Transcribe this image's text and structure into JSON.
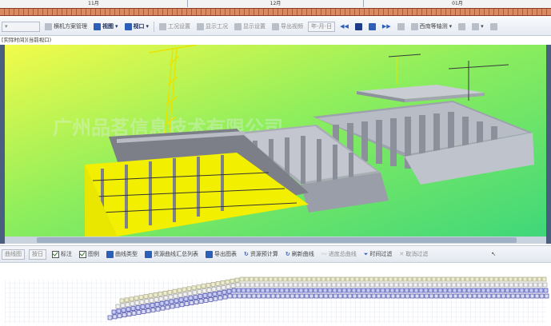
{
  "timeline": {
    "months": [
      "11月",
      "12月",
      "01月"
    ]
  },
  "toolbar": {
    "items": [
      {
        "label": "横机方案管理",
        "icon": "scheme-icon"
      },
      {
        "label": "视图",
        "icon": "view-icon"
      },
      {
        "label": "视口",
        "icon": "viewport-icon"
      },
      {
        "label": "工况设置",
        "icon": "condition-settings-icon"
      },
      {
        "label": "显示工况",
        "icon": "show-condition-icon"
      },
      {
        "label": "显示设置",
        "icon": "display-settings-icon"
      },
      {
        "label": "导出视频",
        "icon": "export-video-icon"
      }
    ],
    "date_format": "年-月-日",
    "view_mode": "西南等轴测"
  },
  "view_label": "[实际时间](当前视口)",
  "viewport": {
    "watermark": "广州品茗信息技术有限公司"
  },
  "bottom_toolbar": {
    "curve_select": "曲线图",
    "unit_select": "按日",
    "mark_label": "标注",
    "legend_label": "图例",
    "items": [
      {
        "label": "曲线类型",
        "icon": "curve-type-icon",
        "dim": false
      },
      {
        "label": "资源曲线汇总列表",
        "icon": "resource-list-icon",
        "dim": false
      },
      {
        "label": "导出图表",
        "icon": "export-chart-icon",
        "dim": false
      },
      {
        "label": "资源预计算",
        "icon": "precompute-icon",
        "dim": false
      },
      {
        "label": "刷新曲线",
        "icon": "refresh-icon",
        "dim": false
      },
      {
        "label": "进度总曲线",
        "icon": "progress-curve-icon",
        "dim": true
      },
      {
        "label": "时间过滤",
        "icon": "time-filter-icon",
        "dim": false
      },
      {
        "label": "取消过滤",
        "icon": "cancel-filter-icon",
        "dim": true
      }
    ]
  },
  "colors": {
    "accent": "#1f3c88",
    "structure_yellow": "#f2f000",
    "concrete_gray": "#a8abb3",
    "sky_green": "#5ee05c"
  }
}
